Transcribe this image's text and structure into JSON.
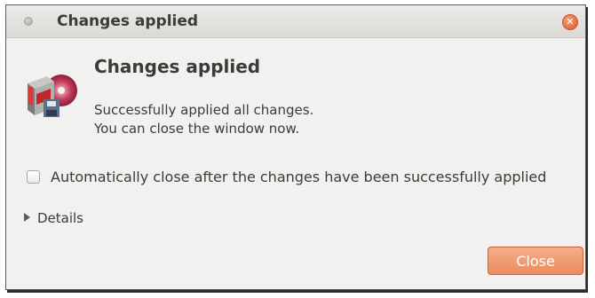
{
  "window": {
    "title": "Changes applied"
  },
  "icons": {
    "window_menu": "window-menu-dot-icon",
    "close": "close-icon",
    "app": "package-installer-icon",
    "expander": "expander-arrow-icon"
  },
  "content": {
    "heading": "Changes applied",
    "message_line1": "Successfully applied all changes.",
    "message_line2": "You can close the window now."
  },
  "options": {
    "auto_close_label": "Automatically close after the changes have been successfully applied",
    "auto_close_checked": false
  },
  "details": {
    "label": "Details",
    "expanded": false
  },
  "buttons": {
    "close_label": "Close"
  },
  "colors": {
    "accent": "#eb8c60",
    "title_close": "#e1541f",
    "text": "#3c3b37",
    "background": "#f2f1f0"
  }
}
